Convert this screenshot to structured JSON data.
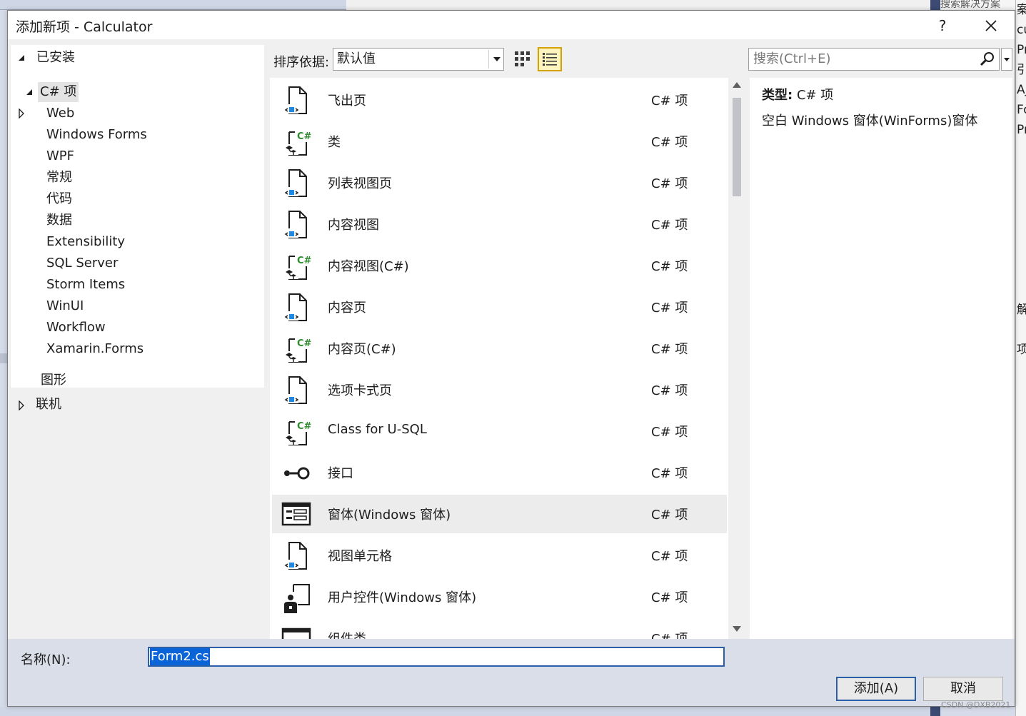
{
  "dialog": {
    "title": "添加新项 - Calculator",
    "help_label": "?"
  },
  "tree": {
    "installed_label": "已安装",
    "csharp_label": "C# 项",
    "children": [
      "Web",
      "Windows Forms",
      "WPF",
      "常规",
      "代码",
      "数据",
      "Extensibility",
      "SQL Server",
      "Storm Items",
      "WinUI",
      "Workflow",
      "Xamarin.Forms"
    ],
    "graphics_label": "图形",
    "online_label": "联机"
  },
  "toolbar": {
    "sort_label": "排序依据:",
    "sort_value": "默认值",
    "search_placeholder": "搜索(Ctrl+E)"
  },
  "items": [
    {
      "name": "飞出页",
      "type": "C# 项",
      "icon": "page-icon"
    },
    {
      "name": "类",
      "type": "C# 项",
      "icon": "csharp-class-icon"
    },
    {
      "name": "列表视图页",
      "type": "C# 项",
      "icon": "page-icon"
    },
    {
      "name": "内容视图",
      "type": "C# 项",
      "icon": "page-icon"
    },
    {
      "name": "内容视图(C#)",
      "type": "C# 项",
      "icon": "csharp-class-icon"
    },
    {
      "name": "内容页",
      "type": "C# 项",
      "icon": "page-icon"
    },
    {
      "name": "内容页(C#)",
      "type": "C# 项",
      "icon": "csharp-class-icon"
    },
    {
      "name": "选项卡式页",
      "type": "C# 项",
      "icon": "page-icon"
    },
    {
      "name": "Class for U-SQL",
      "type": "C# 项",
      "icon": "csharp-class-icon"
    },
    {
      "name": "接口",
      "type": "C# 项",
      "icon": "interface-icon"
    },
    {
      "name": "窗体(Windows 窗体)",
      "type": "C# 项",
      "icon": "form-icon"
    },
    {
      "name": "视图单元格",
      "type": "C# 项",
      "icon": "page-icon"
    },
    {
      "name": "用户控件(Windows 窗体)",
      "type": "C# 项",
      "icon": "user-control-icon"
    },
    {
      "name": "组件类",
      "type": "C# 项",
      "icon": "component-icon"
    }
  ],
  "selected_index": 10,
  "details": {
    "type_label": "类型:",
    "type_value": "C# 项",
    "description": "空白 Windows 窗体(WinForms)窗体"
  },
  "bottom": {
    "name_label": "名称(N):",
    "name_value": "Form2.cs",
    "add_label": "添加(A)",
    "cancel_label": "取消"
  },
  "background": {
    "top_text": "搜索解决方案",
    "right_texts": [
      "案",
      "cu",
      "Pr",
      "引",
      "Aj",
      "Fo",
      "Pr",
      "",
      "",
      "",
      "",
      "",
      "",
      "",
      "",
      "解",
      "",
      "项"
    ]
  },
  "watermark": "CSDN @DXB2021",
  "colors": {
    "accent": "#2b5fa8",
    "selection": "#0a64d8",
    "csharp_green": "#2e8b2e",
    "icon_blue": "#1e88e5"
  }
}
